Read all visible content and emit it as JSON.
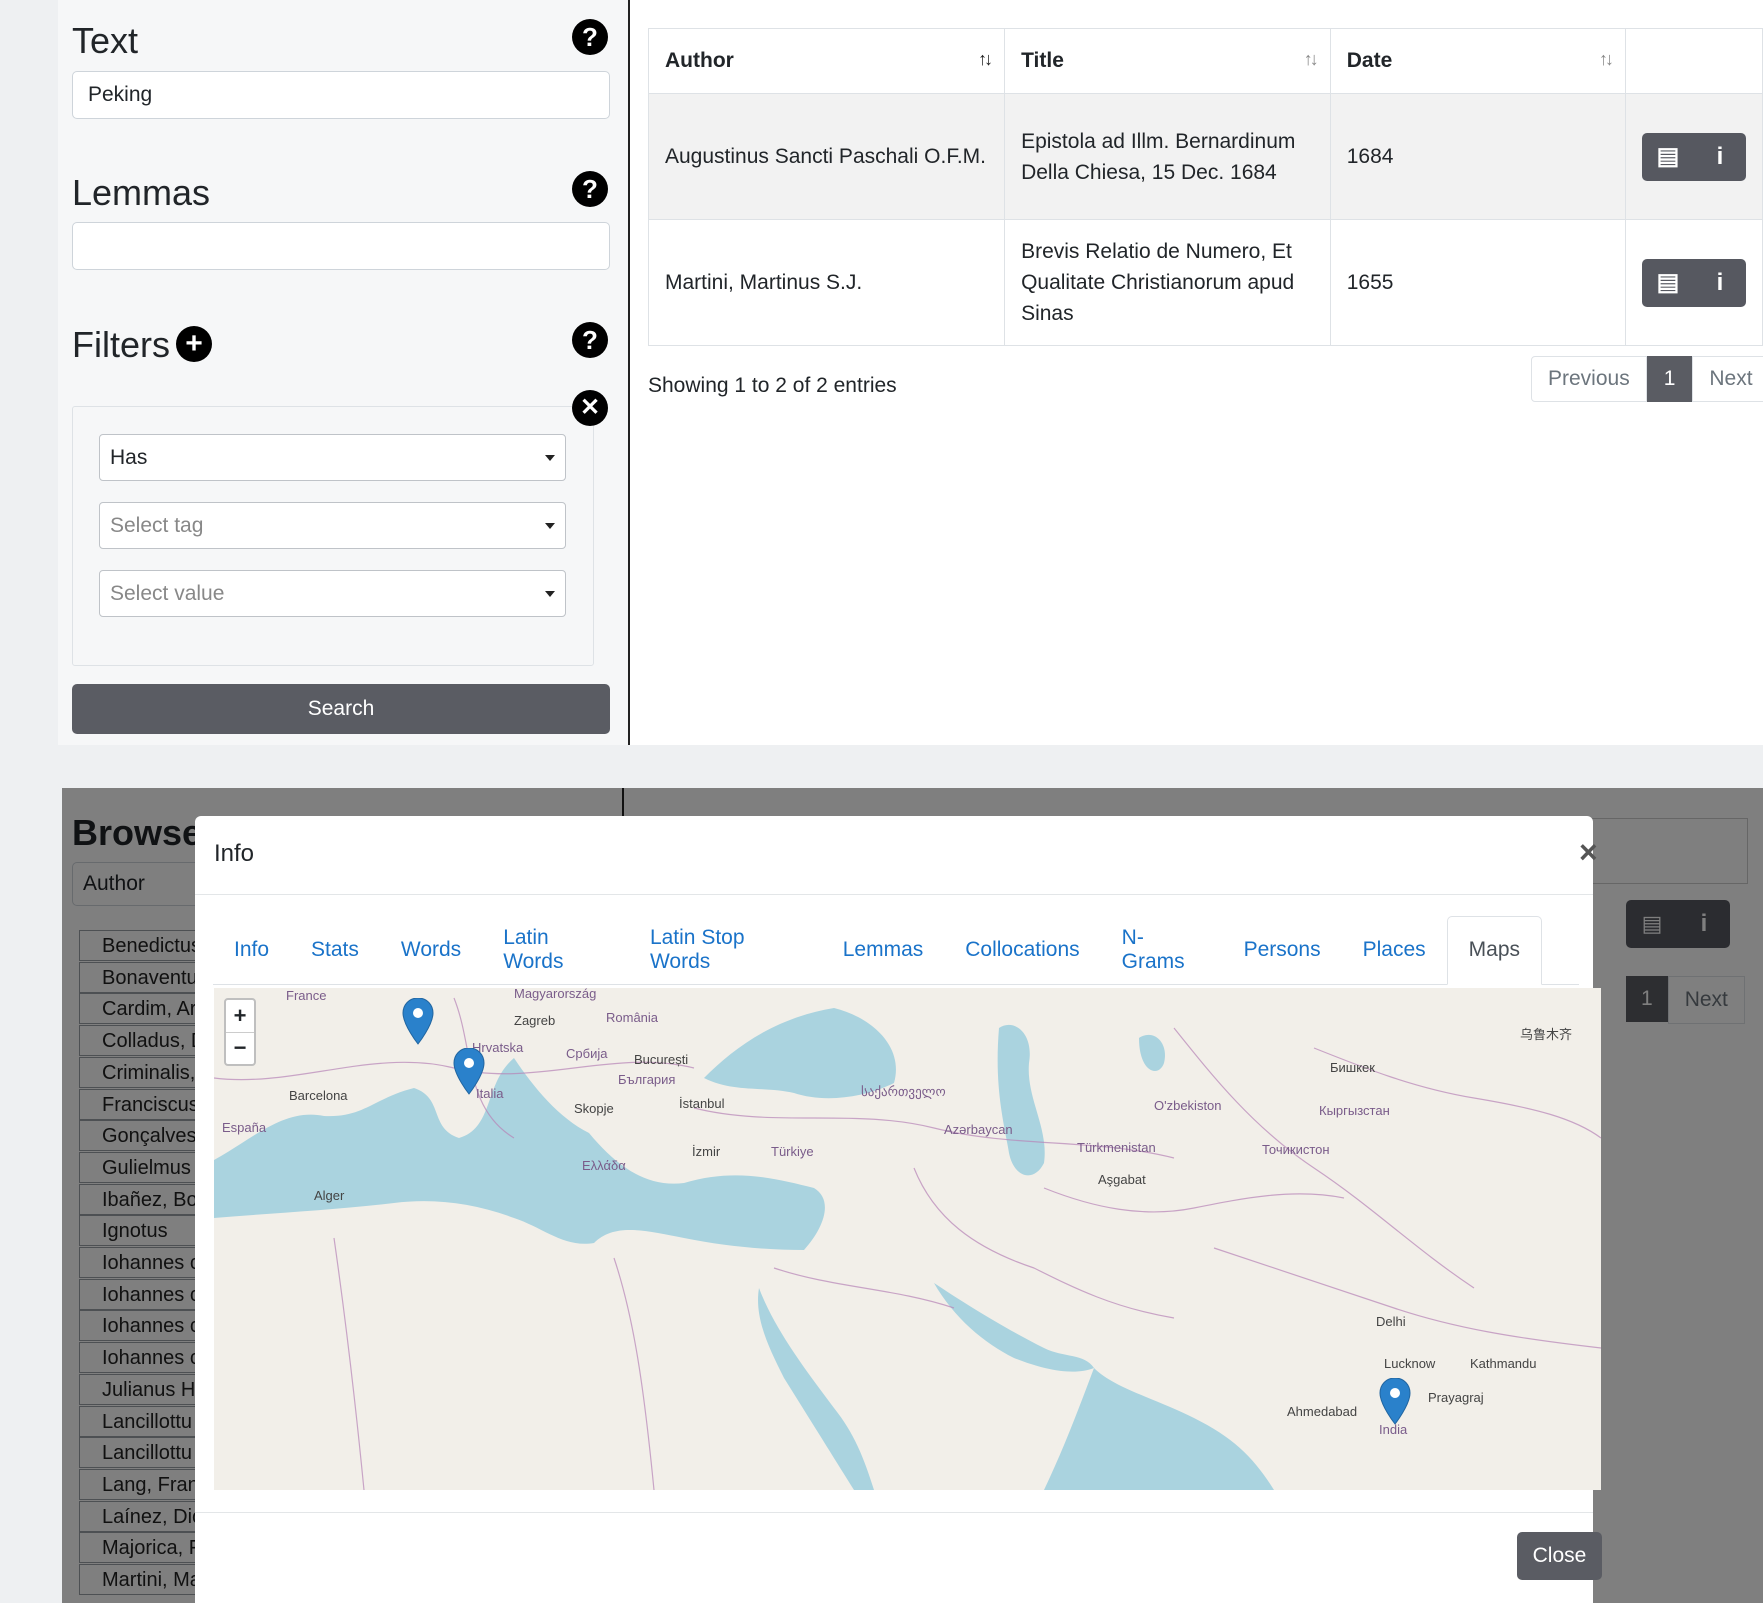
{
  "search_panel": {
    "text_heading": "Text",
    "text_value": "Peking",
    "lemmas_heading": "Lemmas",
    "lemmas_value": "",
    "filters_heading": "Filters",
    "filter": {
      "has_select": "Has",
      "tag_placeholder": "Select tag",
      "value_placeholder": "Select value"
    },
    "search_label": "Search"
  },
  "results": {
    "columns": [
      "Author",
      "Title",
      "Date"
    ],
    "rows": [
      {
        "author": "Augustinus Sancti Paschali O.F.M.",
        "title": "Epistola ad Illm. Bernardinum Della Chiesa, 15 Dec. 1684",
        "date": "1684"
      },
      {
        "author": "Martini, Martinus S.J.",
        "title": "Brevis Relatio de Numero, Et Qualitate Christianorum apud Sinas",
        "date": "1655"
      }
    ],
    "info": "Showing 1 to 2 of 2 entries",
    "pagination": {
      "previous": "Previous",
      "current": "1",
      "next": "Next"
    }
  },
  "browse": {
    "heading": "Browse",
    "select_value": "Author",
    "items": [
      "Benedictus",
      "Bonaventu",
      "Cardim, Ar",
      "Colladus, D",
      "Criminalis,",
      "Franciscus",
      "Gonçalves",
      "Gulielmus",
      "Ibañez, Bo",
      "Ignotus",
      "Iohannes c",
      "Iohannes c",
      "Iohannes c",
      "Iohannes c",
      "Julianus H",
      "Lancillottu",
      "Lancillottu",
      "Lang, Fran",
      "Laínez, Dic",
      "Majorica, F",
      "Martini, Ma"
    ]
  },
  "background_pager": {
    "current": "1",
    "next": "Next"
  },
  "modal": {
    "title": "Info",
    "close_x": "×",
    "tabs": [
      "Info",
      "Stats",
      "Words",
      "Latin Words",
      "Latin Stop Words",
      "Lemmas",
      "Collocations",
      "N-Grams",
      "Persons",
      "Places",
      "Maps"
    ],
    "active_tab": "Maps",
    "close_label": "Close",
    "map": {
      "zoom_in": "+",
      "zoom_out": "−",
      "labels": [
        "France",
        "Magyarország",
        "Zagreb",
        "România",
        "Hrvatska",
        "Србија",
        "București",
        "България",
        "Italia",
        "Barcelona",
        "España",
        "Skopje",
        "İstanbul",
        "Ελλάδα",
        "İzmir",
        "Türkiye",
        "საქართველო",
        "Azərbaycan",
        "Türkmenistan",
        "Aşgabat",
        "O'zbekiston",
        "Кыргызстан",
        "Бишкек",
        "Точикистон",
        "Alger",
        "India",
        "Ahmedabad",
        "Prayagraj",
        "Delhi",
        "Lucknow",
        "Kathmandu",
        "乌鲁木齐"
      ],
      "marker_count": 3
    }
  },
  "colors": {
    "dark_button": "#5a5c63",
    "link_blue": "#1a73c9",
    "water": "#aad3df",
    "land": "#f2efe9",
    "marker": "#2a81cb"
  }
}
